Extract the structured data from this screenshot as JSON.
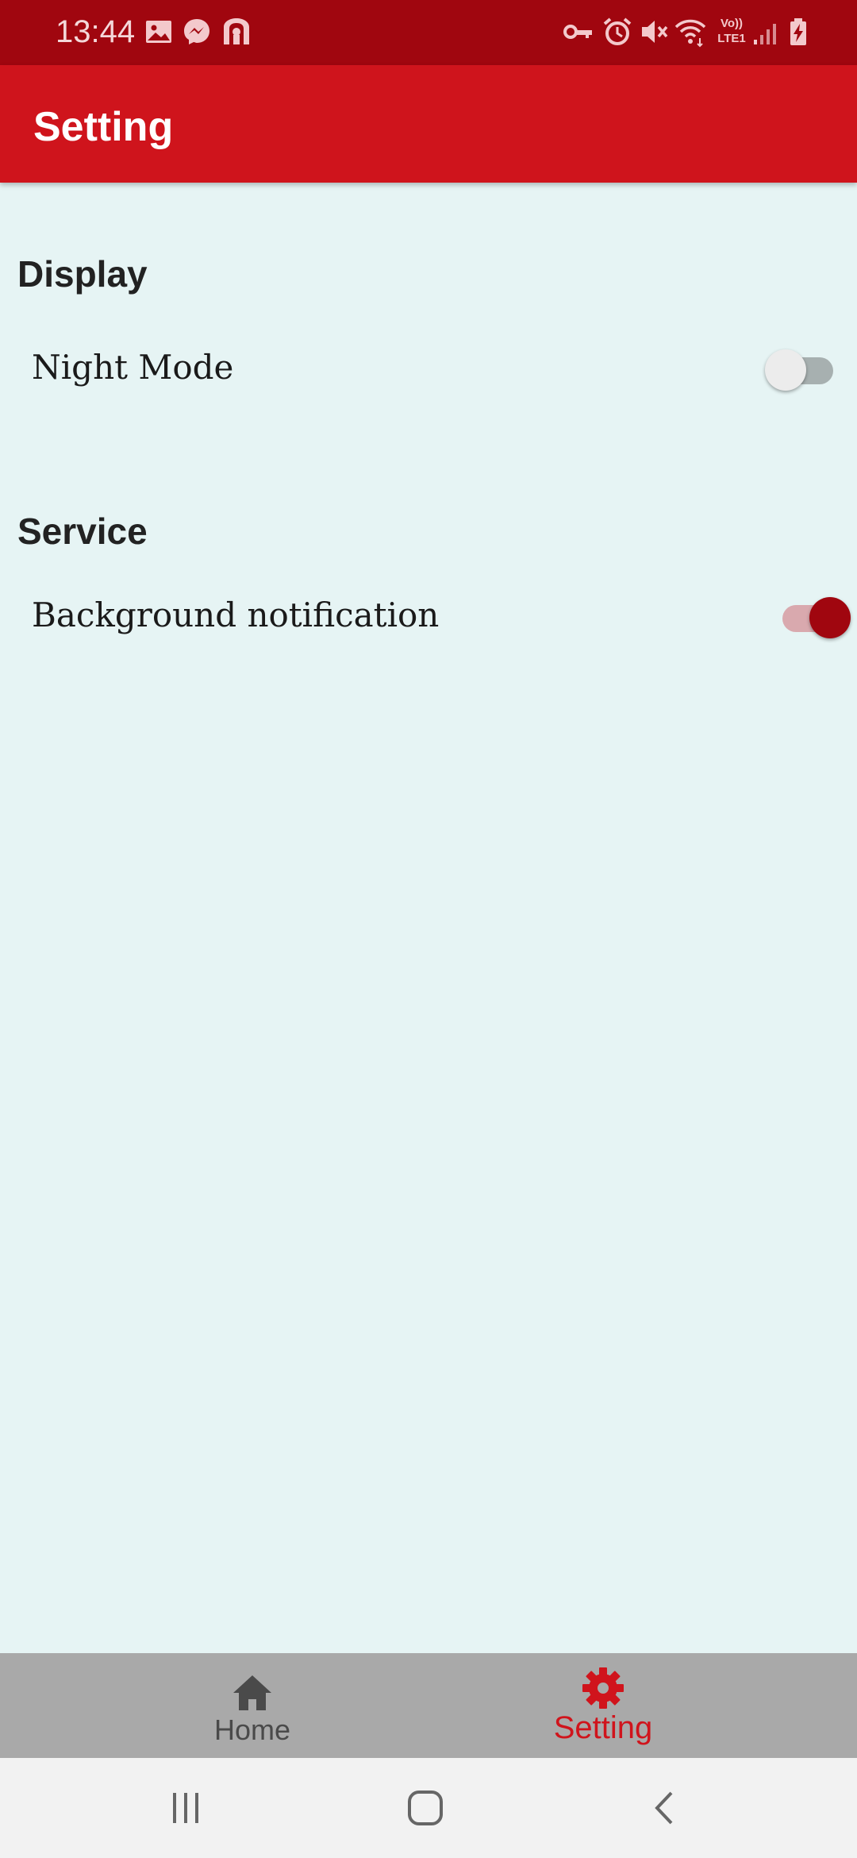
{
  "status_bar": {
    "time": "13:44",
    "left_icons": [
      "image-icon",
      "messenger-icon",
      "vpn-gate-icon"
    ],
    "right_icons": [
      "vpn-key-icon",
      "alarm-icon",
      "mute-icon",
      "wifi-icon",
      "volte-icon",
      "signal-icon",
      "battery-charging-icon"
    ],
    "volte_top": "Vo))",
    "volte_bottom": "LTE1"
  },
  "app_bar": {
    "title": "Setting",
    "color": "#cf141c"
  },
  "sections": [
    {
      "title": "Display",
      "items": [
        {
          "label": "Night Mode",
          "enabled": false
        }
      ]
    },
    {
      "title": "Service",
      "items": [
        {
          "label": "Background notification",
          "enabled": true
        }
      ]
    }
  ],
  "bottom_nav": {
    "items": [
      {
        "label": "Home",
        "icon": "home-icon",
        "active": false
      },
      {
        "label": "Setting",
        "icon": "gear-icon",
        "active": true
      }
    ],
    "active_color": "#d0141c",
    "inactive_color": "#4a4a4a"
  },
  "system_nav": [
    "recent-apps-icon",
    "home-button-icon",
    "back-icon"
  ],
  "colors": {
    "accent": "#a0060f",
    "background": "#e6f4f4"
  }
}
